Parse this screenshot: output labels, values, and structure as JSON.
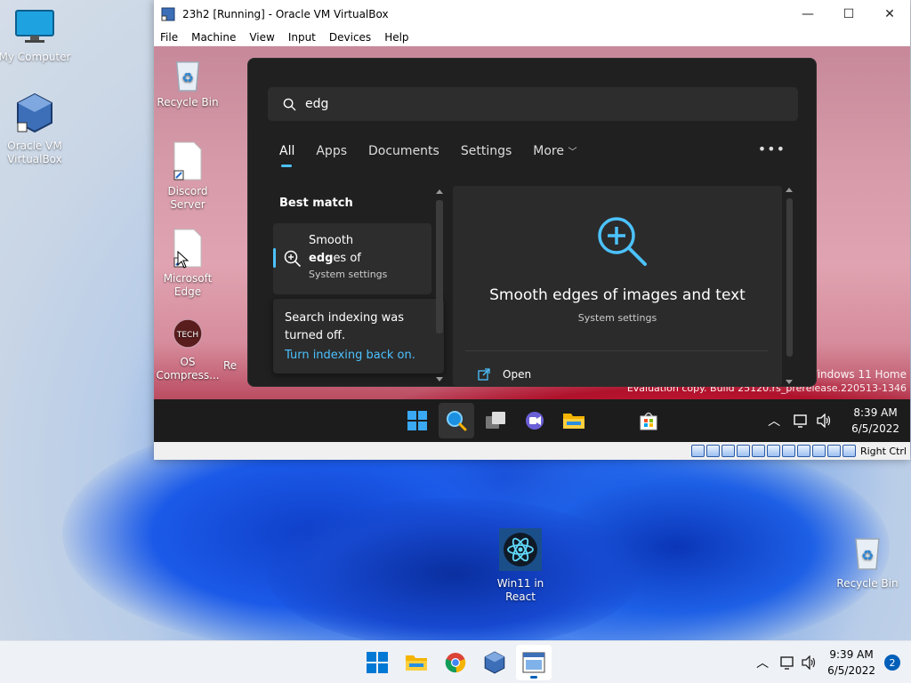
{
  "host_desktop": {
    "icons": [
      {
        "label": "My Computer"
      },
      {
        "label": "Oracle VM VirtualBox"
      },
      {
        "label": "Win11 in React"
      },
      {
        "label": "Recycle Bin"
      }
    ]
  },
  "vbox": {
    "title": "23h2 [Running] - Oracle VM VirtualBox",
    "menu": [
      "File",
      "Machine",
      "View",
      "Input",
      "Devices",
      "Help"
    ],
    "status_label": "Right Ctrl"
  },
  "guest": {
    "icons": [
      {
        "label": "Recycle Bin"
      },
      {
        "label": "Discord Server"
      },
      {
        "label": "Microsoft Edge"
      },
      {
        "label": "OS Compress..."
      },
      {
        "label": "Re"
      }
    ],
    "watermark_line1": "Windows 11 Home",
    "watermark_line2": "Evaluation copy. Build 25120.rs_prerelease.220513-1346",
    "clock_time": "8:39 AM",
    "clock_date": "6/5/2022"
  },
  "search": {
    "query": "edg",
    "tabs": [
      "All",
      "Apps",
      "Documents",
      "Settings",
      "More"
    ],
    "best_match_label": "Best match",
    "result_line1": "Smooth",
    "result_bold": "edg",
    "result_rest": "es of",
    "result_subtitle": "System settings",
    "index_note": "Search indexing was turned off.",
    "index_link": "Turn indexing back on.",
    "detail_title": "Smooth edges of images and text",
    "detail_subtitle": "System settings",
    "detail_action": "Open"
  },
  "host_taskbar": {
    "clock_time": "9:39 AM",
    "clock_date": "6/5/2022",
    "notification_count": "2"
  }
}
